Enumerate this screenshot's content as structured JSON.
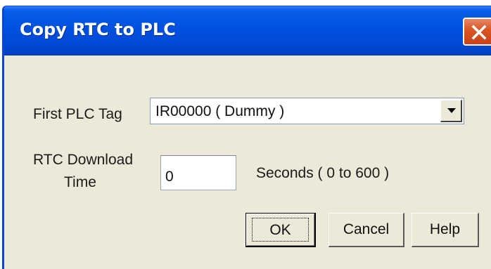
{
  "window": {
    "title": "Copy RTC to PLC"
  },
  "titlebar": {
    "close_icon": "close-x-icon"
  },
  "form": {
    "first_plc_tag": {
      "label": "First PLC Tag",
      "value": "IR00000 ( Dummy )",
      "dropdown_icon": "triangle-down-icon"
    },
    "rtc_download_time": {
      "label_line1": "RTC Download",
      "label_line2": "Time",
      "value": "0",
      "unit_hint": "Seconds ( 0 to 600 )"
    }
  },
  "buttons": {
    "ok_label": "OK",
    "cancel_label": "Cancel",
    "help_label": "Help"
  },
  "colors": {
    "titlebar": "#0052e0",
    "dialog_bg": "#ece9d8",
    "close_button": "#d9541f",
    "title_text": "#ffffff"
  }
}
